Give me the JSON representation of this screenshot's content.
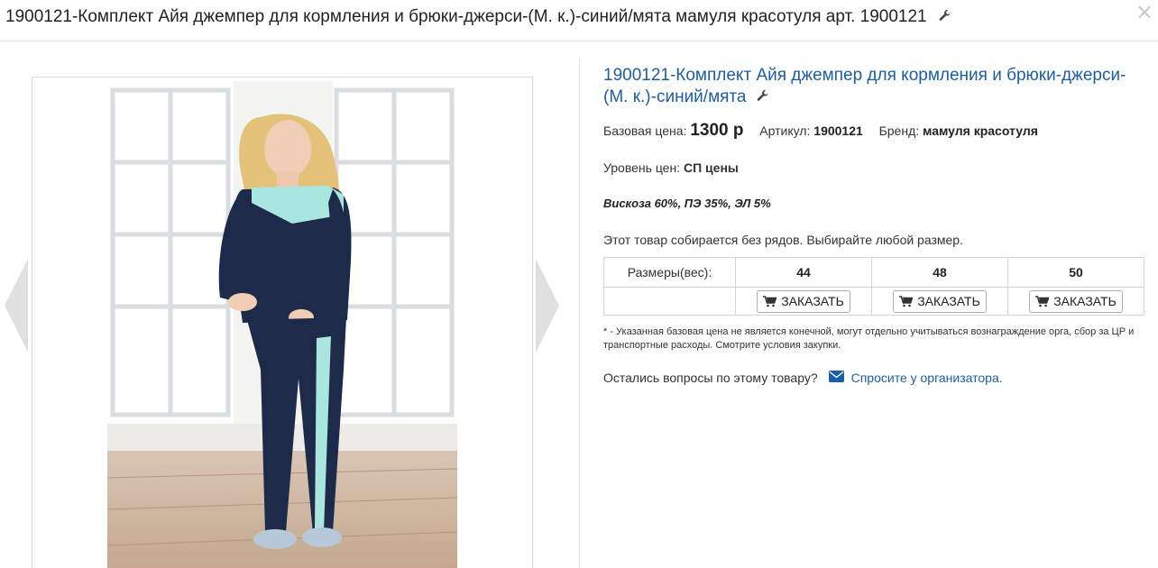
{
  "header": {
    "title": "1900121-Комплект Айя джемпер для кормления и брюки-джерси-(М. к.)-синий/мята мамуля красотуля арт. 1900121",
    "close_label": "×"
  },
  "product": {
    "title": "1900121-Комплект Айя джемпер для кормления и брюки-джерси-(М. к.)-синий/мята",
    "base_price_label": "Базовая цена:",
    "price": "1300 р",
    "article_label": "Артикул:",
    "article": "1900121",
    "brand_label": "Бренд:",
    "brand": "мамуля красотуля",
    "price_level_label": "Уровень цен:",
    "price_level": "СП цены",
    "composition": "Вискоза 60%, ПЭ 35%, ЭЛ 5%",
    "notice": "Этот товар собирается без рядов. Выбирайте любой размер."
  },
  "sizes_table": {
    "header_label": "Размеры(вес):",
    "sizes": [
      "44",
      "48",
      "50"
    ],
    "order_label": "ЗАКАЗАТЬ"
  },
  "footnote": "* - Указанная базовая цена не является конечной, могут отдельно учитываться вознаграждение орга, сбор за ЦР и транспортные расходы. Смотрите условия закупки.",
  "question": {
    "text": "Остались вопросы по этому товару?",
    "link": "Спросите у организатора."
  },
  "icons": [
    "wrench-icon",
    "close-icon",
    "cart-icon",
    "mail-icon",
    "arrow-left-icon",
    "arrow-right-icon"
  ],
  "colors": {
    "link": "#1b5ea8",
    "navy": "#1e2a4a",
    "mint": "#a9e6e0"
  }
}
